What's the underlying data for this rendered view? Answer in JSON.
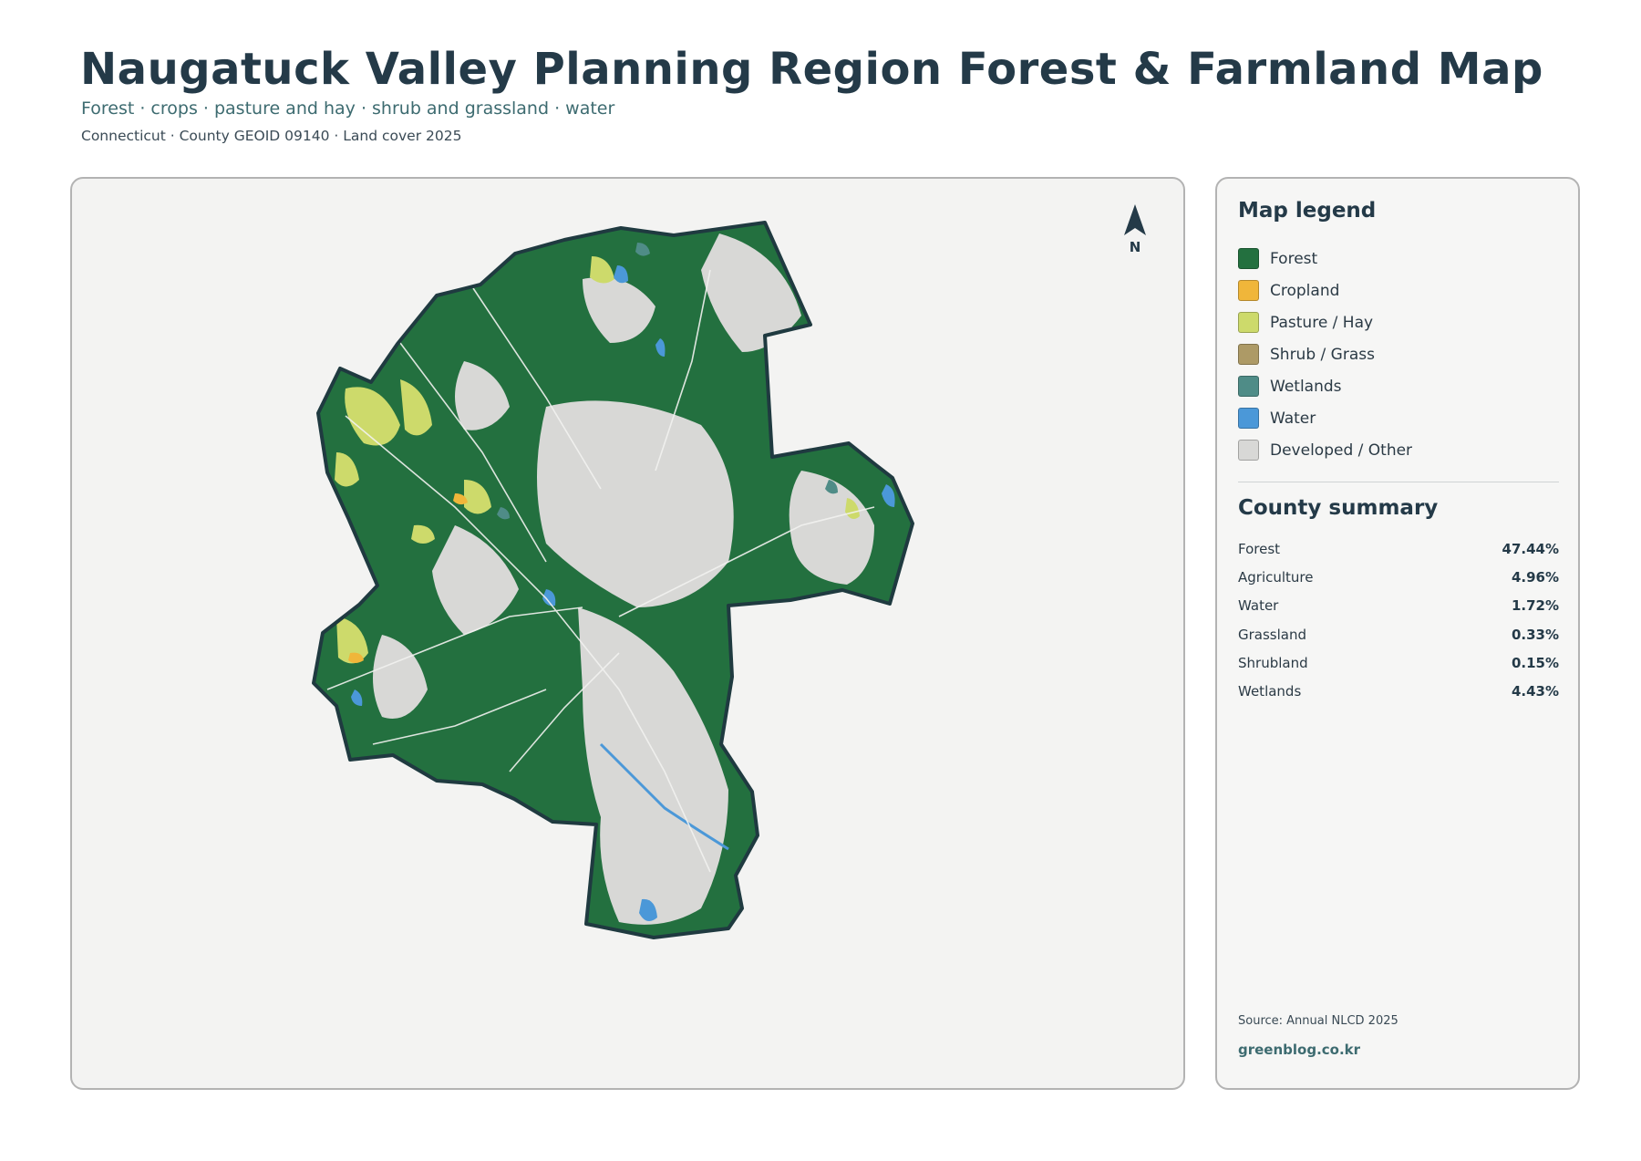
{
  "header": {
    "title": "Naugatuck Valley Planning Region Forest & Farmland Map",
    "subtitle": "Forest · crops · pasture and hay · shrub and grassland · water",
    "meta": "Connecticut · County GEOID 09140 · Land cover 2025"
  },
  "map": {
    "north_label": "N",
    "colors": {
      "forest": "#23703f",
      "cropland": "#f0b63a",
      "pasture": "#cdda6b",
      "shrub_grass": "#ad9a66",
      "wetlands": "#4f8c87",
      "water": "#4b98d8",
      "developed": "#d8d8d6",
      "boundary": "#1f3a40",
      "panel_bg": "#f3f3f2"
    }
  },
  "legend": {
    "title": "Map legend",
    "items": [
      {
        "label": "Forest",
        "color": "#23703f"
      },
      {
        "label": "Cropland",
        "color": "#f0b63a"
      },
      {
        "label": "Pasture / Hay",
        "color": "#cdda6b"
      },
      {
        "label": "Shrub / Grass",
        "color": "#ad9a66"
      },
      {
        "label": "Wetlands",
        "color": "#4f8c87"
      },
      {
        "label": "Water",
        "color": "#4b98d8"
      },
      {
        "label": "Developed / Other",
        "color": "#d8d8d6"
      }
    ]
  },
  "summary": {
    "title": "County summary",
    "rows": [
      {
        "label": "Forest",
        "value": "47.44%"
      },
      {
        "label": "Agriculture",
        "value": "4.96%"
      },
      {
        "label": "Water",
        "value": "1.72%"
      },
      {
        "label": "Grassland",
        "value": "0.33%"
      },
      {
        "label": "Shrubland",
        "value": "0.15%"
      },
      {
        "label": "Wetlands",
        "value": "4.43%"
      }
    ]
  },
  "footer": {
    "source": "Source: Annual NLCD 2025",
    "website": "greenblog.co.kr"
  }
}
